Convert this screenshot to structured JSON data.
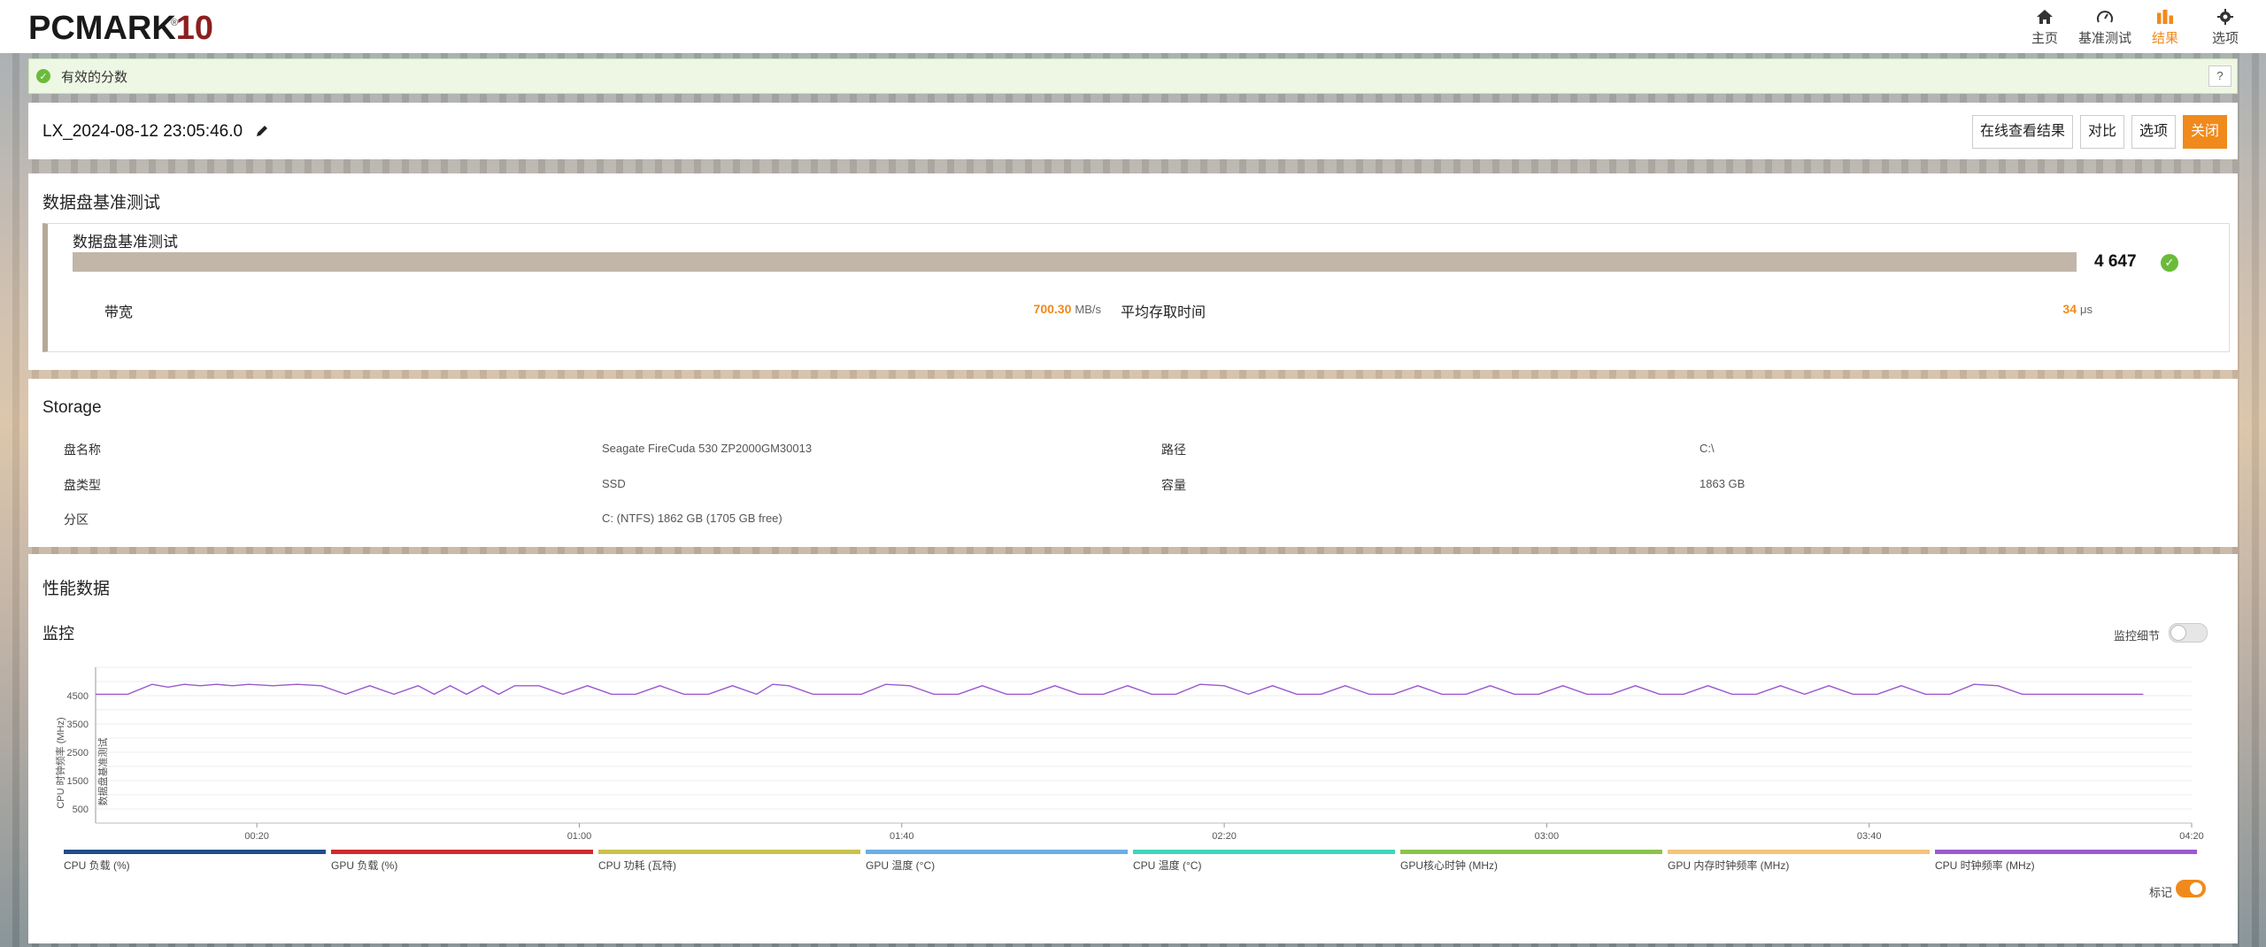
{
  "app": {
    "logo_main": "PCMARK",
    "logo_num": "10",
    "logo_reg": "®"
  },
  "nav": [
    {
      "label": "主页",
      "icon": "home-icon"
    },
    {
      "label": "基准测试",
      "icon": "gauge-icon"
    },
    {
      "label": "结果",
      "icon": "bar-chart-icon",
      "active": true
    },
    {
      "label": "选项",
      "icon": "gear-icon"
    }
  ],
  "banner": {
    "text": "有效的分数",
    "help": "?"
  },
  "result": {
    "title": "LX_2024-08-12 23:05:46.0",
    "buttons": {
      "online": "在线查看结果",
      "compare": "对比",
      "options": "选项",
      "close": "关闭"
    }
  },
  "benchmark": {
    "section_title": "数据盘基准测试",
    "name": "数据盘基准测试",
    "score": "4 647",
    "bandwidth_label": "带宽",
    "bandwidth_value": "700.30",
    "bandwidth_unit": "MB/s",
    "access_label": "平均存取时间",
    "access_value": "34",
    "access_unit": "μs"
  },
  "storage": {
    "title": "Storage",
    "rows": [
      {
        "label": "盘名称",
        "value": "Seagate FireCuda 530 ZP2000GM30013"
      },
      {
        "label": "盘类型",
        "value": "SSD"
      },
      {
        "label": "分区",
        "value": "C: (NTFS) 1862 GB (1705 GB free)"
      }
    ],
    "right_rows": [
      {
        "label": "路径",
        "value": "C:\\"
      },
      {
        "label": "容量",
        "value": "1863 GB"
      }
    ]
  },
  "performance": {
    "title": "性能数据",
    "monitor_title": "监控",
    "monitor_detail_label": "监控细节",
    "marker_label": "标记",
    "legend": [
      {
        "label": "CPU 负载 (%)",
        "color": "#1f4e8c"
      },
      {
        "label": "GPU 负载 (%)",
        "color": "#d12b2b"
      },
      {
        "label": "CPU 功耗 (瓦特)",
        "color": "#c9c24a"
      },
      {
        "label": "GPU 温度 (°C)",
        "color": "#6aaee6"
      },
      {
        "label": "CPU 温度 (°C)",
        "color": "#3fd6b8"
      },
      {
        "label": "GPU核心时钟 (MHz)",
        "color": "#8bc34a"
      },
      {
        "label": "GPU 内存时钟频率 (MHz)",
        "color": "#f2c57a"
      },
      {
        "label": "CPU 时钟频率 (MHz)",
        "color": "#9b59d0"
      }
    ]
  },
  "chart_data": {
    "type": "line",
    "ylabel": "CPU 时钟频率 (MHz)",
    "ylabel2": "数据盘基准测试",
    "y_ticks": [
      500,
      1500,
      2500,
      3500,
      4500
    ],
    "ylim": [
      0,
      5500
    ],
    "x_ticks": [
      "00:20",
      "01:00",
      "01:40",
      "02:20",
      "03:00",
      "03:40",
      "04:20"
    ],
    "xlim_seconds": [
      0,
      260
    ],
    "series": [
      {
        "name": "CPU 时钟频率 (MHz)",
        "color": "#9b59d0",
        "x": [
          0,
          4,
          7,
          9,
          11,
          13,
          15,
          17,
          19,
          22,
          25,
          28,
          31,
          34,
          37,
          40,
          42,
          44,
          46,
          48,
          50,
          52,
          55,
          58,
          61,
          64,
          67,
          70,
          73,
          76,
          79,
          82,
          84,
          86,
          89,
          92,
          95,
          98,
          101,
          104,
          107,
          110,
          113,
          116,
          119,
          122,
          125,
          128,
          131,
          134,
          137,
          140,
          143,
          146,
          149,
          152,
          155,
          158,
          161,
          164,
          167,
          170,
          173,
          176,
          179,
          182,
          185,
          188,
          191,
          194,
          197,
          200,
          203,
          206,
          209,
          212,
          215,
          218,
          221,
          224,
          227,
          230,
          233,
          236,
          239,
          242,
          245,
          248,
          251,
          254
        ],
        "y": [
          4550,
          4550,
          4900,
          4800,
          4900,
          4850,
          4900,
          4850,
          4900,
          4850,
          4900,
          4850,
          4550,
          4850,
          4550,
          4850,
          4550,
          4850,
          4550,
          4850,
          4550,
          4850,
          4850,
          4550,
          4850,
          4550,
          4550,
          4850,
          4550,
          4550,
          4850,
          4550,
          4900,
          4850,
          4550,
          4550,
          4550,
          4900,
          4850,
          4550,
          4550,
          4850,
          4550,
          4550,
          4850,
          4550,
          4550,
          4850,
          4550,
          4550,
          4900,
          4850,
          4550,
          4850,
          4550,
          4550,
          4850,
          4550,
          4550,
          4850,
          4550,
          4550,
          4850,
          4550,
          4550,
          4850,
          4550,
          4550,
          4850,
          4550,
          4550,
          4850,
          4550,
          4550,
          4850,
          4550,
          4850,
          4550,
          4550,
          4850,
          4550,
          4550,
          4900,
          4850,
          4550,
          4550,
          4550,
          4550,
          4550,
          4550
        ]
      }
    ]
  }
}
